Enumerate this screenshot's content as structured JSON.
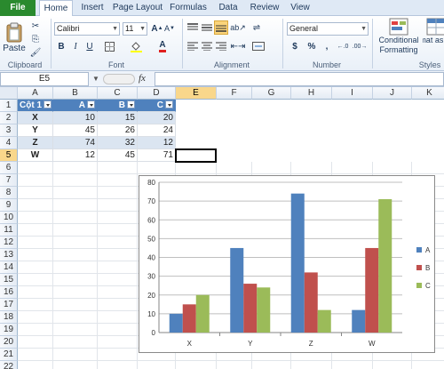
{
  "ribbon_tabs": [
    "File",
    "Home",
    "Insert",
    "Page Layout",
    "Formulas",
    "Data",
    "Review",
    "View"
  ],
  "active_tab": "Home",
  "clipboard": {
    "paste_label": "Paste",
    "group_label": "Clipboard"
  },
  "font": {
    "family": "Calibri",
    "size": "11",
    "group_label": "Font",
    "bold": "B",
    "italic": "I",
    "underline": "U"
  },
  "alignment": {
    "group_label": "Alignment"
  },
  "number": {
    "format": "General",
    "group_label": "Number",
    "currency": "$",
    "percent": "%",
    "comma": ","
  },
  "styles": {
    "conditional_formatting": "Conditional Formatting",
    "format_as_table": "Format as Table",
    "group_label": "Styles"
  },
  "formula_bar": {
    "name_box": "E5",
    "fx": "fx",
    "content": ""
  },
  "columns": [
    "A",
    "B",
    "C",
    "D",
    "E",
    "F",
    "G",
    "H",
    "I",
    "J",
    "K"
  ],
  "selected_column": "E",
  "rows": [
    "1",
    "2",
    "3",
    "4",
    "5",
    "6",
    "7",
    "8",
    "9",
    "10",
    "11",
    "12",
    "13",
    "14",
    "15",
    "16",
    "17",
    "18",
    "19",
    "20",
    "21",
    "22"
  ],
  "selected_row": "5",
  "table": {
    "headers": [
      "Cột 1",
      "A",
      "B",
      "C"
    ],
    "rows": [
      [
        "X",
        "10",
        "15",
        "20"
      ],
      [
        "Y",
        "45",
        "26",
        "24"
      ],
      [
        "Z",
        "74",
        "32",
        "12"
      ],
      [
        "W",
        "12",
        "45",
        "71"
      ]
    ]
  },
  "colors": {
    "series_a": "#4f81bd",
    "series_b": "#c0504d",
    "series_c": "#9bbb59",
    "table_header": "#4f81bd",
    "table_band": "#dbe5f1",
    "file_tab": "#2a8a2e"
  },
  "chart_data": {
    "type": "bar",
    "categories": [
      "X",
      "Y",
      "Z",
      "W"
    ],
    "series": [
      {
        "name": "A",
        "values": [
          10,
          45,
          74,
          12
        ]
      },
      {
        "name": "B",
        "values": [
          15,
          26,
          32,
          45
        ]
      },
      {
        "name": "C",
        "values": [
          20,
          24,
          12,
          71
        ]
      }
    ],
    "ylim": [
      0,
      80
    ],
    "yticks": [
      0,
      10,
      20,
      30,
      40,
      50,
      60,
      70,
      80
    ],
    "grid": true,
    "legend": "right"
  }
}
